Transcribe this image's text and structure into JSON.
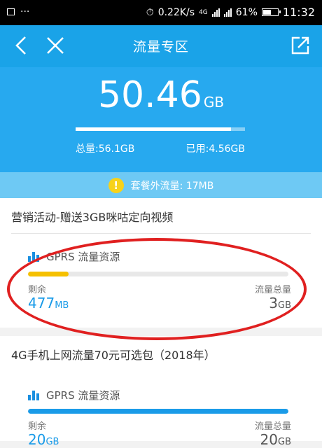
{
  "status_bar": {
    "speed": "0.22K/s",
    "net": "4G",
    "battery": "61%",
    "battery_level": 0.61,
    "time": "11:32"
  },
  "header": {
    "title": "流量专区",
    "icons": [
      "back-icon",
      "close-icon",
      "share-icon"
    ]
  },
  "summary": {
    "remaining_value": "50.46",
    "remaining_unit": "GB",
    "usage_fraction": 0.919,
    "total": "总量:56.1GB",
    "used": "已用:4.56GB"
  },
  "extra": {
    "text": "套餐外流量: 17MB"
  },
  "packages": [
    {
      "title": "营销活动-赠送3GB咪咕定向视频",
      "resource_label": "GPRS 流量资源",
      "bar_color": "#f5c000",
      "remaining_fraction": 0.155,
      "remaining_label": "剩余",
      "remaining_value": "477",
      "remaining_unit": "MB",
      "total_label": "流量总量",
      "total_value": "3",
      "total_unit": "GB"
    },
    {
      "title": "4G手机上网流量70元可选包（2018年）",
      "resource_label": "GPRS 流量资源",
      "bar_color": "#1a9be8",
      "remaining_fraction": 1.0,
      "remaining_label": "剩余",
      "remaining_value": "20",
      "remaining_unit": "GB",
      "total_label": "流量总量",
      "total_value": "20",
      "total_unit": "GB"
    }
  ],
  "colors": {
    "header_blue": "#1aa3e8",
    "summary_blue": "#27a9ef",
    "highlight_red": "#e02020"
  }
}
